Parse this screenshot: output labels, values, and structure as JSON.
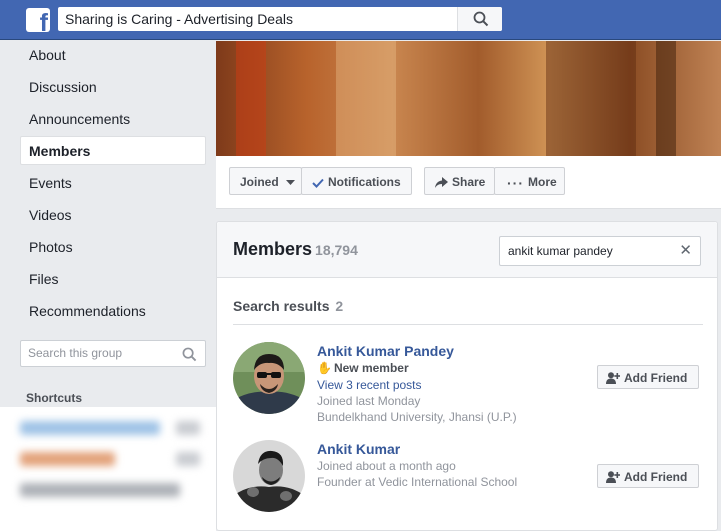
{
  "header": {
    "logo": "f",
    "search_value": "Sharing is Caring - Advertising Deals",
    "search_icon": "search-icon"
  },
  "sidebar": {
    "items": [
      {
        "label": "About"
      },
      {
        "label": "Discussion"
      },
      {
        "label": "Announcements"
      },
      {
        "label": "Members",
        "active": true
      },
      {
        "label": "Events"
      },
      {
        "label": "Videos"
      },
      {
        "label": "Photos"
      },
      {
        "label": "Files"
      },
      {
        "label": "Recommendations"
      }
    ],
    "search_placeholder": "Search this group",
    "shortcuts_title": "Shortcuts"
  },
  "actions": {
    "joined": "Joined",
    "notifications": "Notifications",
    "share": "Share",
    "more": "More"
  },
  "members": {
    "title": "Members",
    "count": "18,794",
    "search_value": "ankit kumar pandey",
    "results_label": "Search results",
    "results_count": "2",
    "list": [
      {
        "name": "Ankit Kumar Pandey",
        "badge": "New member",
        "link": "View 3 recent posts",
        "joined": "Joined last Monday",
        "detail": "Bundelkhand University, Jhansi (U.P.)",
        "button": "Add Friend"
      },
      {
        "name": "Ankit Kumar",
        "joined": "Joined about a month ago",
        "detail": "Founder at Vedic International School",
        "button": "Add Friend"
      }
    ]
  },
  "colors": {
    "brand": "#4267b2",
    "link": "#365899",
    "page_bg": "#e9ebee"
  }
}
